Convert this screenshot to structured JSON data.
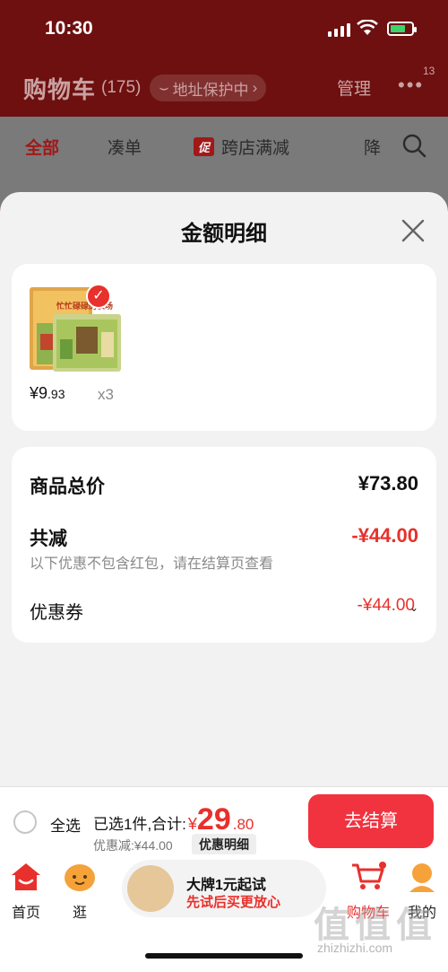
{
  "status": {
    "time": "10:30"
  },
  "header": {
    "title": "购物车",
    "count": "(175)",
    "address_pill": "地址保护中",
    "manage": "管理",
    "more_badge": "13"
  },
  "tabs": [
    {
      "label": "全部"
    },
    {
      "label": "凑单"
    },
    {
      "label": "跨店满减",
      "tag": "促"
    },
    {
      "label": "降"
    }
  ],
  "sheet": {
    "title": "金额明细",
    "item": {
      "price_int": "¥9",
      "price_dec": ".93",
      "qty": "x3",
      "cover_text": "忙忙碌碌的农场"
    },
    "rows": {
      "total_label": "商品总价",
      "total_value": "¥73.80",
      "reduce_label": "共减",
      "reduce_value": "-¥44.00",
      "note": "以下优惠不包含红包，请在结算页查看",
      "coupon_label": "优惠券",
      "coupon_value": "-¥44.00"
    }
  },
  "checkout": {
    "select_all": "全选",
    "selected_text": "已选1件,合计:",
    "total_yen": "¥",
    "total_int": "29",
    "total_dec": ".80",
    "discount_line": "优惠减:¥44.00",
    "detail_chip": "优惠明细",
    "checkout_button": "去结算"
  },
  "nav": {
    "home": "首页",
    "browse": "逛",
    "banner_line1": "大牌1元起试",
    "banner_line2": "先试后买更放心",
    "cart": "购物车",
    "me": "我的"
  },
  "watermark": {
    "logo": "值值值",
    "url": "zhizhizhi.com"
  },
  "colors": {
    "accent": "#e8302c",
    "header_bg": "#8a1f1f",
    "button": "#f0333f"
  }
}
